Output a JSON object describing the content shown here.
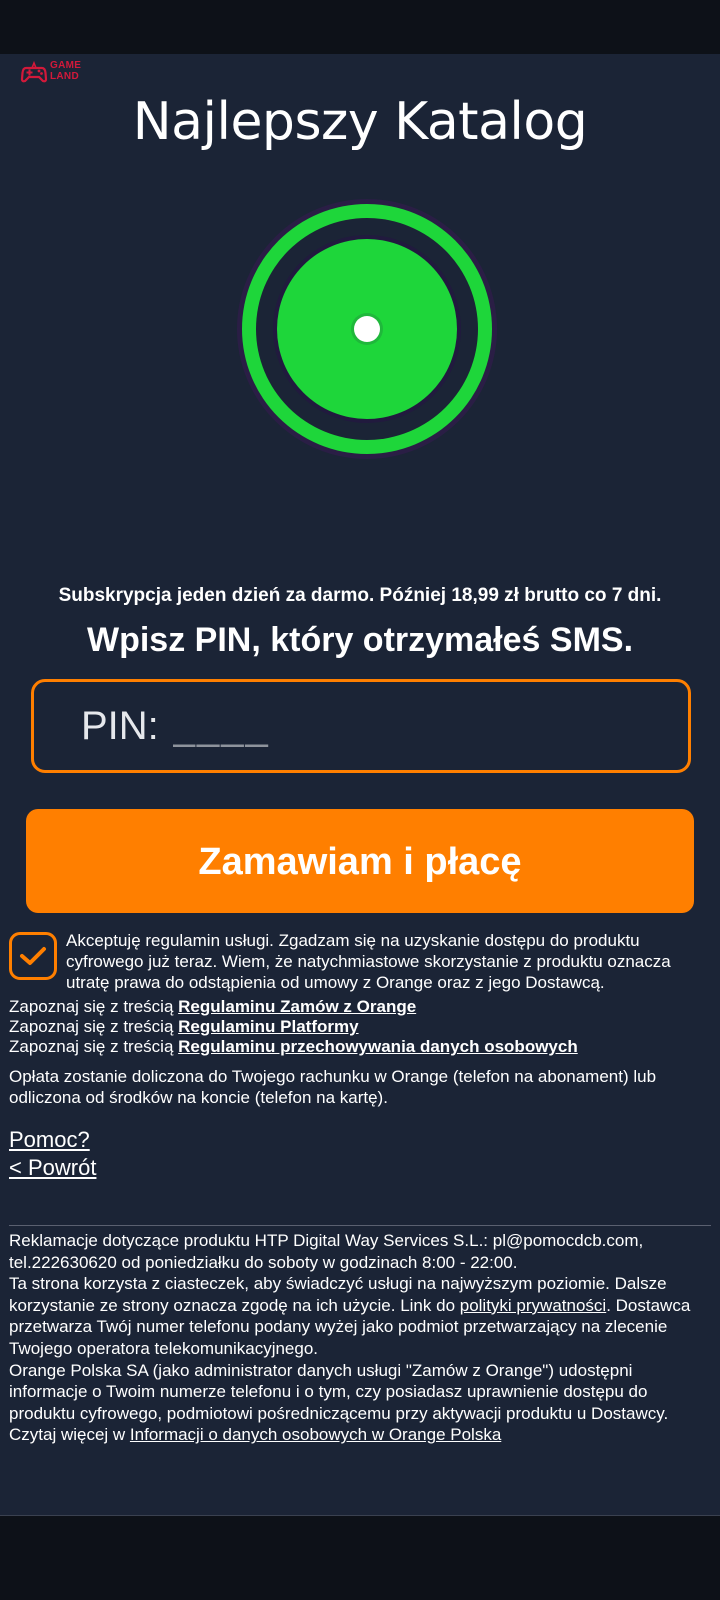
{
  "logo": {
    "line1": "GAME",
    "line2": "LAND",
    "brand_color": "#d2193a"
  },
  "brand_title": "Najlepszy Katalog",
  "subscription_text": "Subskrypcja jeden dzień za darmo. Później 18,99 zł brutto co 7 dni.",
  "pin_heading": "Wpisz PIN, który otrzymałeś SMS.",
  "pin": {
    "label": "PIN:",
    "placeholder": "____",
    "value": ""
  },
  "order_button": "Zamawiam i płacę",
  "consent": {
    "checked": true,
    "text": "Akceptuję regulamin usługi. Zgadzam się na uzyskanie dostępu do produktu cyfrowego już teraz. Wiem, że natychmiastowe skorzystanie z produktu oznacza utratę prawa do odstąpienia od umowy z Orange oraz z jego Dostawcą."
  },
  "terms_links": [
    {
      "prefix": "Zapoznaj się z treścią ",
      "link": "Regulaminu Zamów z Orange"
    },
    {
      "prefix": "Zapoznaj się z treścią ",
      "link": "Regulaminu Platformy"
    },
    {
      "prefix": "Zapoznaj się z treścią ",
      "link": "Regulaminu przechowywania danych osobowych"
    }
  ],
  "billing_text": "Opłata zostanie doliczona do Twojego rachunku w Orange (telefon na abonament) lub odliczona od środków na koncie (telefon na kartę).",
  "help_link": "Pomoc?",
  "back_link": "< Powrót",
  "footer": {
    "complaints": "Reklamacje dotyczące produktu HTP Digital Way Services S.L.: pl@pomocdcb.com, tel.222630620 od poniedziałku do soboty w godzinach 8:00 - 22:00.",
    "cookies_before": "Ta strona korzysta z ciasteczek, aby świadczyć usługi na najwyższym poziomie. Dalsze korzystanie ze strony oznacza zgodę na ich użycie. Link do ",
    "privacy_link": "polityki prywatności",
    "cookies_after": ". Dostawca przetwarza Twój numer telefonu podany wyżej jako podmiot przetwarzający na zlecenie Twojego operatora telekomunikacyjnego.",
    "orange_before": "Orange Polska SA (jako administrator danych usługi \"Zamów z Orange\") udostępni informacje o Twoim numerze telefonu i o tym, czy posiadasz uprawnienie dostępu do produktu cyfrowego, podmiotowi pośredniczącemu przy aktywacji produktu u Dostawcy. Czytaj więcej w ",
    "orange_link": "Informacji o danych osobowych w Orange Polska"
  },
  "colors": {
    "background": "#1b2436",
    "accent": "#ff7f00",
    "hero_green": "#1ed63a"
  }
}
